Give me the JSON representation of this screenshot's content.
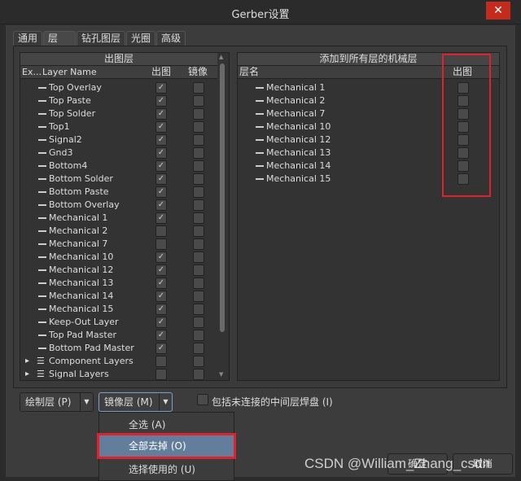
{
  "window": {
    "title": "Gerber设置",
    "close_icon": "close-icon"
  },
  "tabs": [
    {
      "label": "通用"
    },
    {
      "label": "层"
    },
    {
      "label": "钻孔图层"
    },
    {
      "label": "光圈"
    },
    {
      "label": "高级"
    }
  ],
  "left_panel": {
    "title": "出图层",
    "columns": [
      "Ex...",
      "Layer Name",
      "出图",
      "镜像"
    ],
    "rows": [
      {
        "name": "Top Overlay",
        "plot": true,
        "mirror": false
      },
      {
        "name": "Top Paste",
        "plot": true,
        "mirror": false
      },
      {
        "name": "Top Solder",
        "plot": true,
        "mirror": false
      },
      {
        "name": "Top1",
        "plot": true,
        "mirror": false
      },
      {
        "name": "Signal2",
        "plot": true,
        "mirror": false
      },
      {
        "name": "Gnd3",
        "plot": true,
        "mirror": false
      },
      {
        "name": "Bottom4",
        "plot": true,
        "mirror": false
      },
      {
        "name": "Bottom Solder",
        "plot": true,
        "mirror": false
      },
      {
        "name": "Bottom Paste",
        "plot": true,
        "mirror": false
      },
      {
        "name": "Bottom Overlay",
        "plot": true,
        "mirror": false
      },
      {
        "name": "Mechanical 1",
        "plot": true,
        "mirror": false
      },
      {
        "name": "Mechanical 2",
        "plot": false,
        "mirror": false
      },
      {
        "name": "Mechanical 7",
        "plot": false,
        "mirror": false
      },
      {
        "name": "Mechanical 10",
        "plot": true,
        "mirror": false
      },
      {
        "name": "Mechanical 12",
        "plot": true,
        "mirror": false
      },
      {
        "name": "Mechanical 13",
        "plot": true,
        "mirror": false
      },
      {
        "name": "Mechanical 14",
        "plot": true,
        "mirror": false
      },
      {
        "name": "Mechanical 15",
        "plot": true,
        "mirror": false
      },
      {
        "name": "Keep-Out Layer",
        "plot": true,
        "mirror": false
      },
      {
        "name": "Top Pad Master",
        "plot": true,
        "mirror": false
      },
      {
        "name": "Bottom Pad Master",
        "plot": true,
        "mirror": false
      },
      {
        "name": "Component Layers",
        "plot": false,
        "mirror": false,
        "group": true
      },
      {
        "name": "Signal Layers",
        "plot": false,
        "mirror": false,
        "group": true
      }
    ]
  },
  "right_panel": {
    "title": "添加到所有层的机械层",
    "columns": [
      "层名",
      "出图"
    ],
    "rows": [
      {
        "name": "Mechanical 1",
        "plot": false
      },
      {
        "name": "Mechanical 2",
        "plot": false
      },
      {
        "name": "Mechanical 7",
        "plot": false
      },
      {
        "name": "Mechanical 10",
        "plot": false
      },
      {
        "name": "Mechanical 12",
        "plot": false
      },
      {
        "name": "Mechanical 13",
        "plot": false
      },
      {
        "name": "Mechanical 14",
        "plot": false
      },
      {
        "name": "Mechanical 15",
        "plot": false
      }
    ]
  },
  "bottom": {
    "plot_layers": "绘制层 (P)",
    "mirror_layers": "镜像层 (M)",
    "include_pads": "包括未连接的中间层焊盘 (I)",
    "include_pads_checked": false
  },
  "menu": {
    "items": [
      {
        "label": "全选 (A)"
      },
      {
        "label": "全部去掉 (O)",
        "highlighted": true
      },
      {
        "label": "选择使用的 (U)"
      }
    ]
  },
  "buttons": {
    "ok": "确定",
    "cancel": "取消"
  },
  "watermark": "CSDN @William_Zhang_csdn",
  "colors": {
    "highlight": "#627e9c",
    "annotation": "#e0202a",
    "close": "#c42b1c"
  }
}
